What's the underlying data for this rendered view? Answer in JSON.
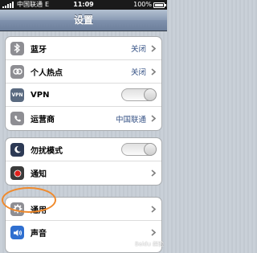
{
  "status_bar": {
    "carrier": "中国联通",
    "network": "E",
    "time": "11:09",
    "battery": "100%"
  },
  "nav": {
    "title": "设置"
  },
  "groups": [
    {
      "rows": [
        {
          "label": "蓝牙",
          "value": "关闭",
          "icon": "bluetooth-icon",
          "icon_color": "#8e8e93"
        },
        {
          "label": "个人热点",
          "value": "关闭",
          "icon": "hotspot-icon",
          "icon_color": "#8e8e93"
        },
        {
          "label": "VPN",
          "toggle": "off",
          "icon": "vpn-icon",
          "icon_color": "#5a6a80"
        },
        {
          "label": "运营商",
          "value": "中国联通",
          "icon": "carrier-phone-icon",
          "icon_color": "#8e8e93"
        }
      ]
    },
    {
      "rows": [
        {
          "label": "勿扰模式",
          "toggle": "off",
          "icon": "moon-icon",
          "icon_color": "#2d3a55"
        },
        {
          "label": "通知",
          "icon": "notification-icon",
          "icon_color": "#3a3a3a"
        }
      ]
    },
    {
      "rows": [
        {
          "label": "通用",
          "icon": "gear-icon",
          "icon_color": "#8e8e93"
        },
        {
          "label": "声音",
          "icon": "speaker-icon",
          "icon_color": "#2f6fd0"
        }
      ]
    }
  ],
  "watermark": "Baidu 经验"
}
